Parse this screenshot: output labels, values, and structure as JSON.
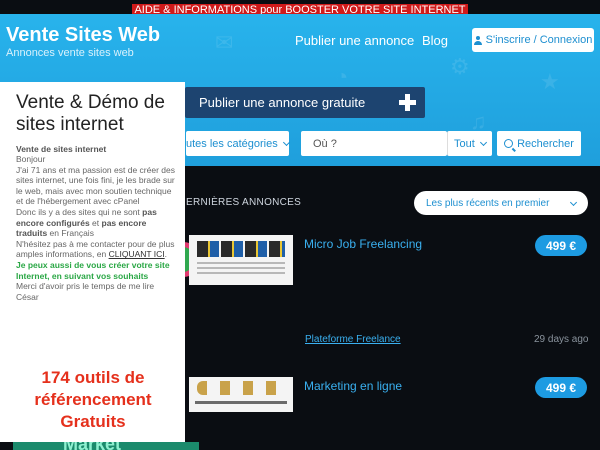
{
  "banner": {
    "text": "AIDE & INFORMATIONS pour BOOSTER VOTRE SITE INTERNET",
    "color": "#d01a1a"
  },
  "brand": {
    "title": "Vente Sites Web",
    "subtitle": "Annonces vente sites web"
  },
  "nav": {
    "publish_label": "Publier une annonce",
    "blog_label": "Blog",
    "signin_label": "S'inscrire / Connexion",
    "signin_icon": "user-icon"
  },
  "hero": {
    "cta_label": "Publier une annonce gratuite",
    "cta_icon": "plus-icon",
    "accent": "#22aae6"
  },
  "search": {
    "category_value": "utes les catégories",
    "where_placeholder": "Où ?",
    "scope_value": "Tout",
    "submit_label": "Rechercher",
    "submit_icon": "search-icon"
  },
  "listings": {
    "section_title": "ERNIÈRES ANNONCES",
    "sort_value": "Les plus récents en premier",
    "items": [
      {
        "title": "Micro Job Freelancing",
        "price": "499 €"
      },
      {
        "category": "Plateforme Freelance",
        "time": "29 days ago"
      },
      {
        "title": "Marketing en ligne",
        "price": "499 €"
      }
    ]
  },
  "promo": {
    "title": "Vente & Démo de sites internet",
    "heading": "Vente de sites internet",
    "greeting": "Bonjour",
    "para1": "J'ai  71 ans et ma passion est de créer des sites internet, une fois fini, je les brade sur le web, mais avec mon soutien technique et de l'hébergement avec cPanel",
    "para2_a": "Donc ils y a des sites qui ne sont ",
    "para2_b": "pas encore configurés",
    "para2_c": " et ",
    "para2_d": "pas encore traduits",
    "para2_e": " en Français",
    "para3_a": "N'hésitez pas à me contacter pour de plus amples informations, en ",
    "para3_b": "CLIQUANT ICI",
    "para3_c": ".",
    "green_text": "Je peux aussi de vous créer votre site Internet, en suivant vos souhaits",
    "thanks": "Merci d'avoir pris le temps de me lire",
    "signature": "César",
    "big_text": "174 outils de référencement Gratuits",
    "bottom_text": "Market"
  }
}
